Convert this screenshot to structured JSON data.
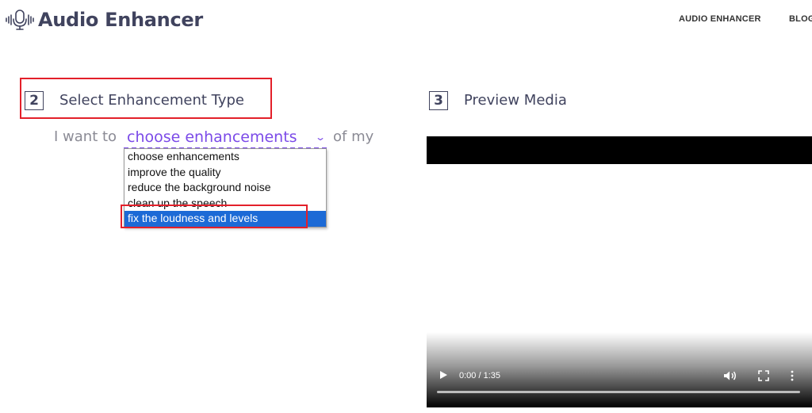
{
  "header": {
    "logo_icon": "microphone-waveform-icon",
    "title": "Audio Enhancer",
    "nav": [
      "AUDIO ENHANCER",
      "BLOG"
    ]
  },
  "step2": {
    "number": "2",
    "title": "Select Enhancement Type",
    "prefix": "I want to",
    "suffix": "of my",
    "select": {
      "value": "choose enhancements",
      "options": [
        "choose enhancements",
        "improve the quality",
        "reduce the background noise",
        "clean up the speech",
        "fix the loudness and levels"
      ],
      "highlighted_index": 4
    }
  },
  "step3": {
    "number": "3",
    "title": "Preview Media"
  },
  "player": {
    "time": "0:00 / 1:35",
    "progress": 0,
    "icons": [
      "play-icon",
      "volume-icon",
      "fullscreen-icon",
      "more-options-icon"
    ]
  },
  "colors": {
    "accent": "#7b4ae8",
    "selected_option": "#1c6ad6",
    "annotation": "#e3202a",
    "heading": "#40435e"
  }
}
